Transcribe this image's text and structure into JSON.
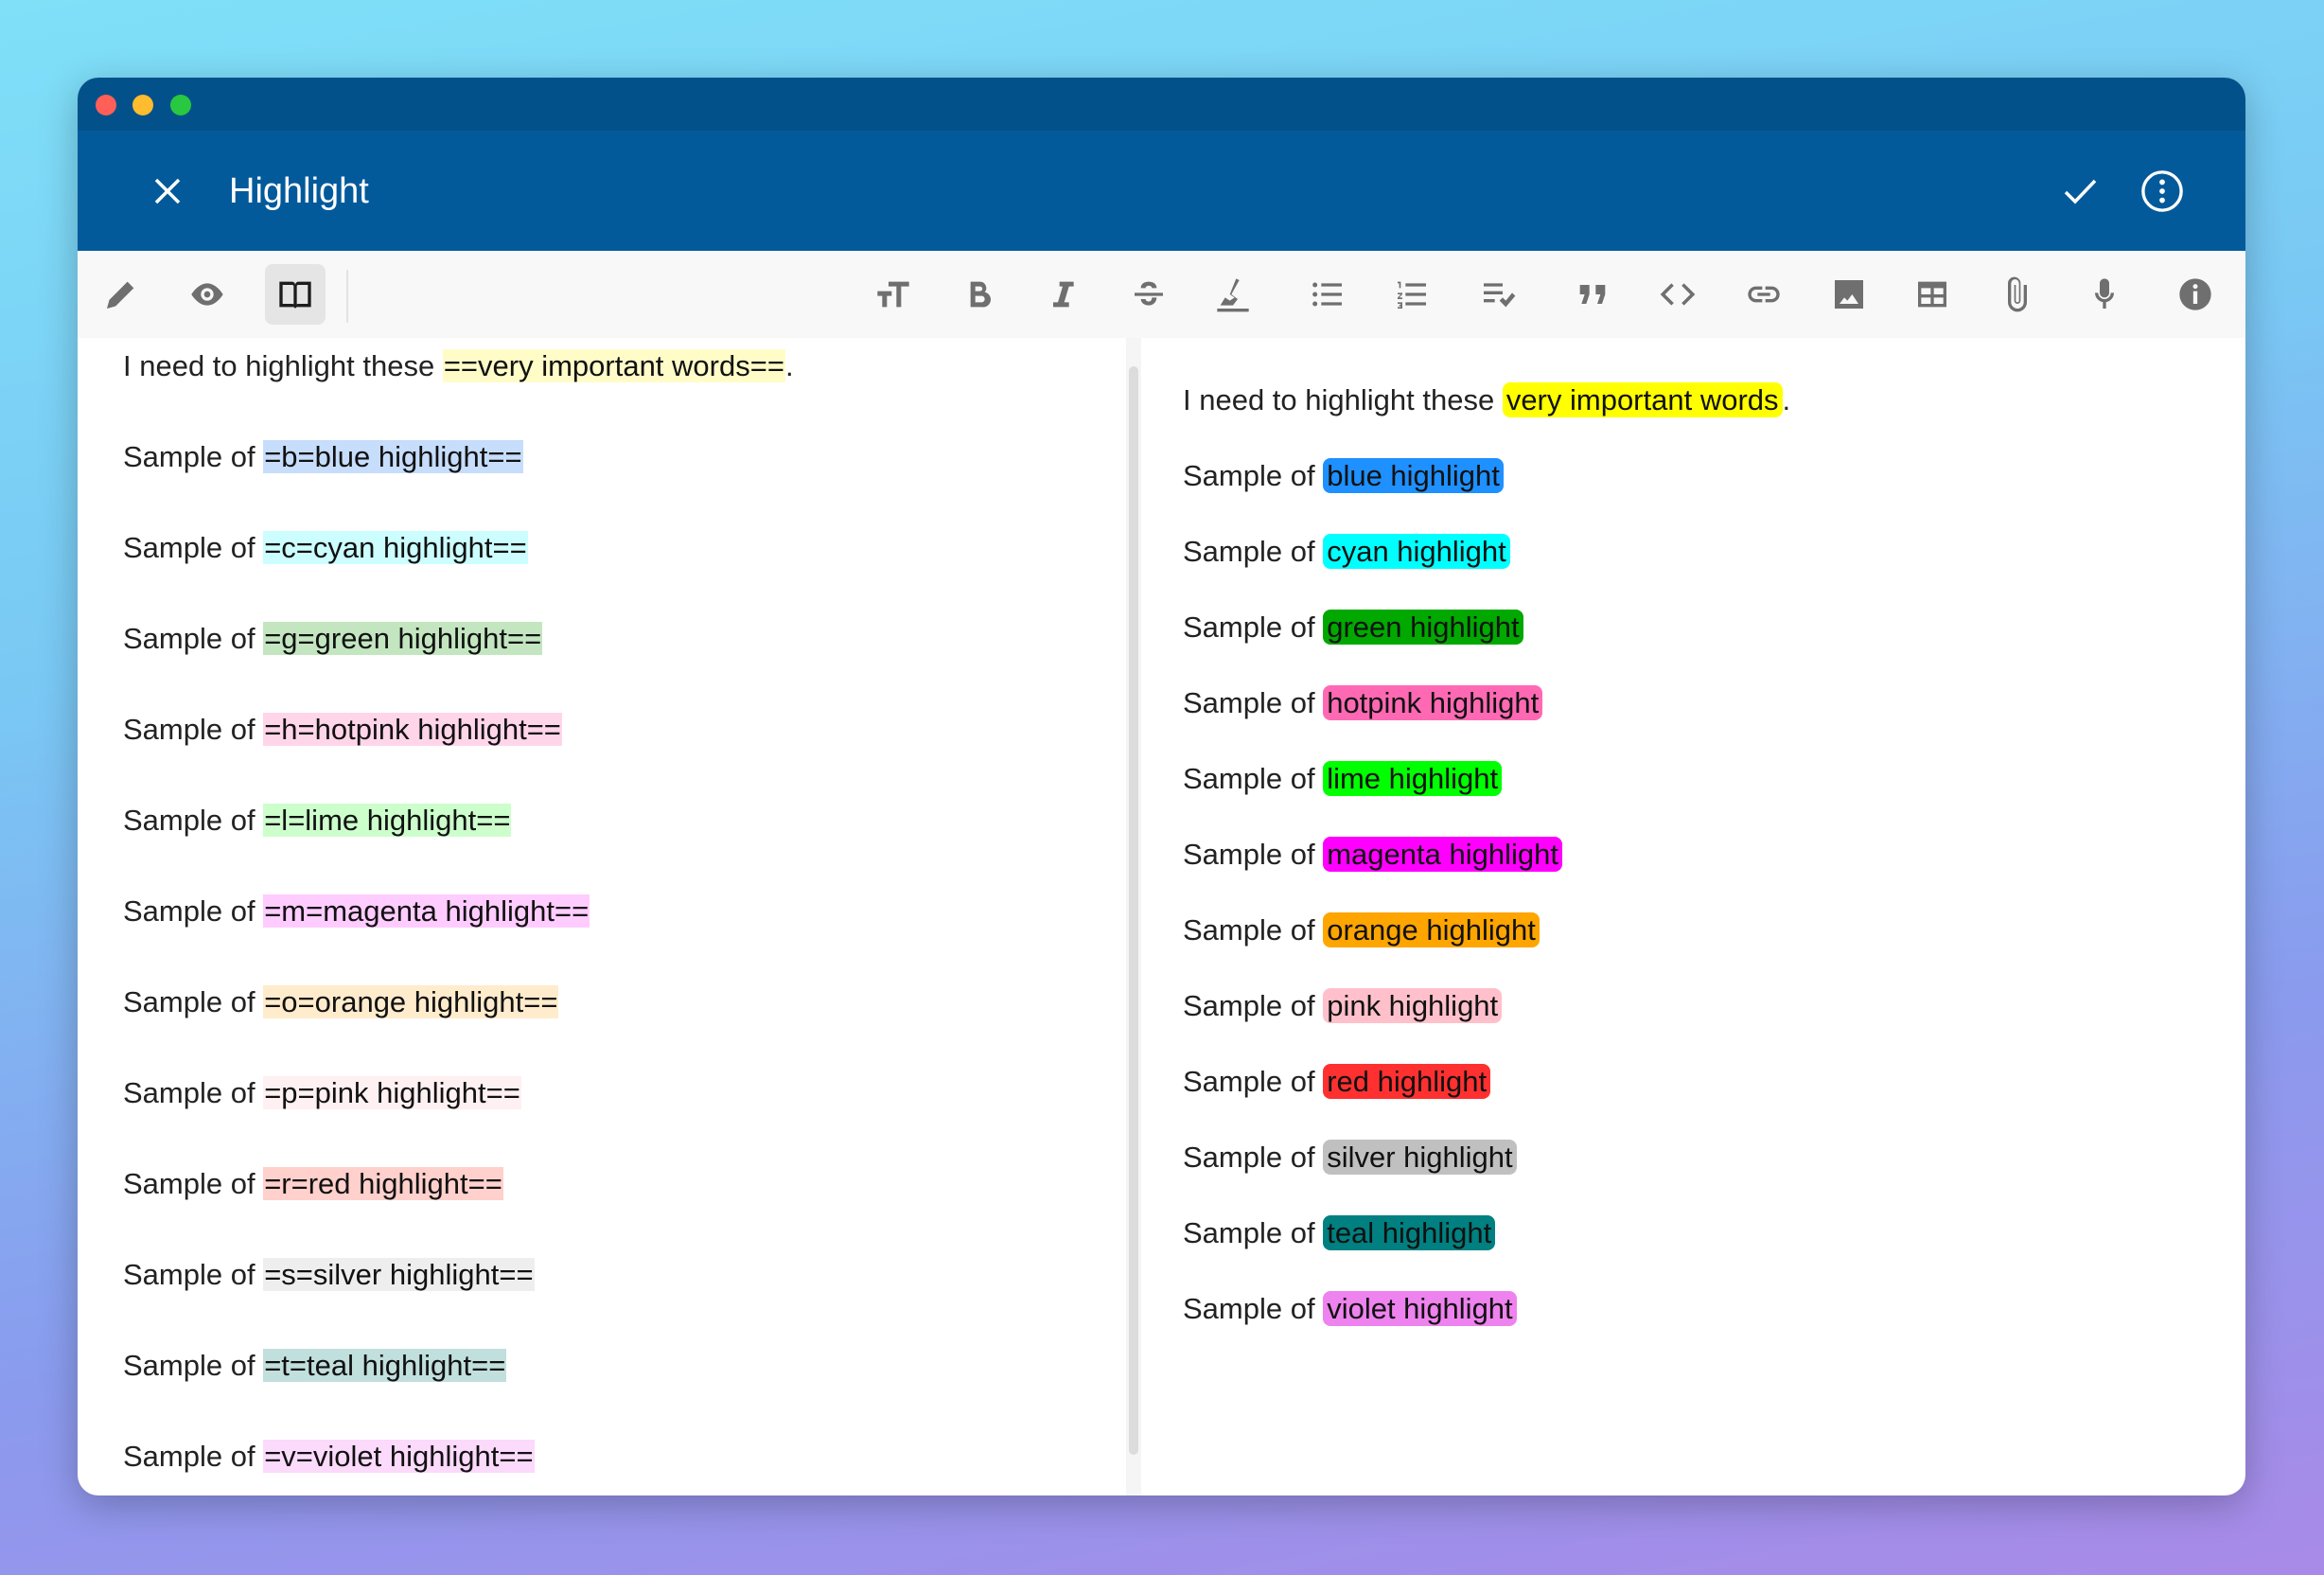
{
  "window": {
    "traffic_lights": {
      "close": "#ff5f57",
      "minimize": "#febc2e",
      "zoom": "#28c840"
    }
  },
  "header": {
    "title": "Highlight",
    "close_icon": "close-icon",
    "confirm_icon": "check-icon",
    "more_icon": "more-vertical-circle-icon",
    "background": "#025a9b"
  },
  "toolbar": {
    "modes": [
      {
        "name": "edit",
        "icon": "pencil-icon"
      },
      {
        "name": "preview",
        "icon": "eye-icon"
      },
      {
        "name": "reading",
        "icon": "book-icon",
        "active": true
      }
    ],
    "tools": [
      "text-size-icon",
      "bold-icon",
      "italic-icon",
      "strikethrough-icon",
      "highlighter-icon",
      "bullet-list-icon",
      "numbered-list-icon",
      "checklist-icon",
      "quote-icon",
      "code-icon",
      "link-icon",
      "image-icon",
      "table-icon",
      "attachment-icon",
      "microphone-icon",
      "info-icon"
    ]
  },
  "editor": {
    "intro": {
      "prefix": "I need to highlight these ",
      "marked": "==very important words==",
      "suffix": ".",
      "color": "#fffcc8"
    },
    "lines": [
      {
        "prefix": "Sample of ",
        "marked": "=b=blue highlight==",
        "color": "#c6ddfb"
      },
      {
        "prefix": "Sample of ",
        "marked": "=c=cyan highlight==",
        "color": "#ccfeff"
      },
      {
        "prefix": "Sample of ",
        "marked": "=g=green highlight==",
        "color": "#c3e6c0"
      },
      {
        "prefix": "Sample of ",
        "marked": "=h=hotpink highlight==",
        "color": "#ffd5e9"
      },
      {
        "prefix": "Sample of ",
        "marked": "=l=lime highlight==",
        "color": "#ccffcc"
      },
      {
        "prefix": "Sample of ",
        "marked": "=m=magenta highlight==",
        "color": "#ffccff"
      },
      {
        "prefix": "Sample of ",
        "marked": "=o=orange highlight==",
        "color": "#ffeccc"
      },
      {
        "prefix": "Sample of ",
        "marked": "=p=pink highlight==",
        "color": "#fff0f2"
      },
      {
        "prefix": "Sample of ",
        "marked": "=r=red highlight==",
        "color": "#ffd0cc"
      },
      {
        "prefix": "Sample of ",
        "marked": "=s=silver highlight==",
        "color": "#eeeeee"
      },
      {
        "prefix": "Sample of ",
        "marked": "=t=teal highlight==",
        "color": "#c0dfdd"
      },
      {
        "prefix": "Sample of ",
        "marked": "=v=violet highlight==",
        "color": "#fbdafb"
      }
    ]
  },
  "preview": {
    "intro": {
      "prefix": "I need to highlight these ",
      "marked": "very important words",
      "suffix": ".",
      "color": "#ffff00"
    },
    "lines": [
      {
        "prefix": "Sample of ",
        "marked": "blue highlight",
        "color": "#1e90ff"
      },
      {
        "prefix": "Sample of ",
        "marked": "cyan highlight",
        "color": "#00ffff"
      },
      {
        "prefix": "Sample of ",
        "marked": "green highlight",
        "color": "#00a800"
      },
      {
        "prefix": "Sample of ",
        "marked": "hotpink highlight",
        "color": "#ff69b4"
      },
      {
        "prefix": "Sample of ",
        "marked": "lime highlight",
        "color": "#00ff00"
      },
      {
        "prefix": "Sample of ",
        "marked": "magenta highlight",
        "color": "#ff00ff"
      },
      {
        "prefix": "Sample of ",
        "marked": "orange highlight",
        "color": "#ffa500"
      },
      {
        "prefix": "Sample of ",
        "marked": "pink highlight",
        "color": "#ffc0cb"
      },
      {
        "prefix": "Sample of ",
        "marked": "red highlight",
        "color": "#ff3030"
      },
      {
        "prefix": "Sample of ",
        "marked": "silver highlight",
        "color": "#c0c0c0"
      },
      {
        "prefix": "Sample of ",
        "marked": "teal highlight",
        "color": "#008080"
      },
      {
        "prefix": "Sample of ",
        "marked": "violet highlight",
        "color": "#ee82ee"
      }
    ]
  }
}
